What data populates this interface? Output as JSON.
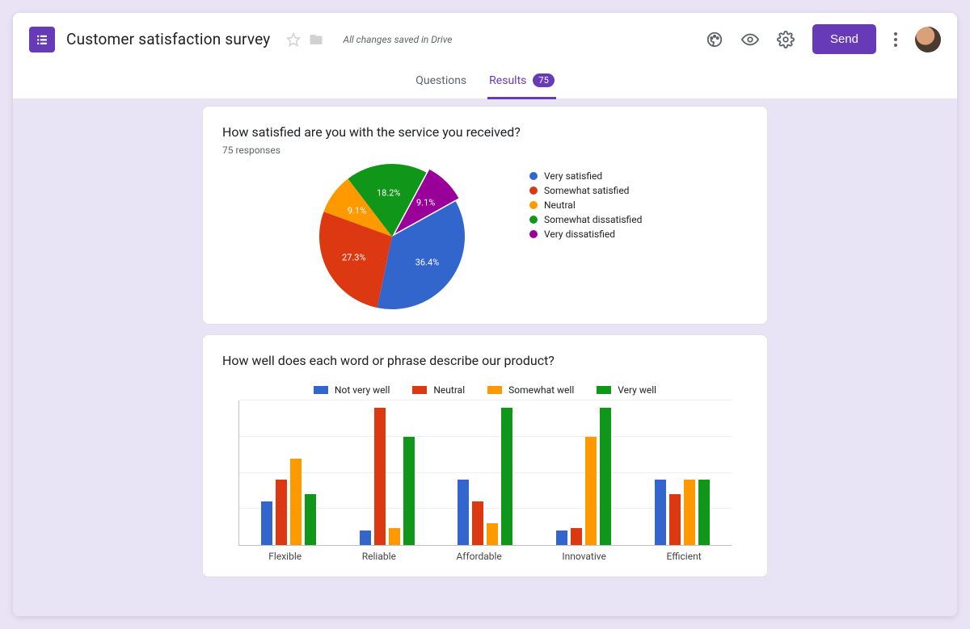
{
  "header": {
    "title": "Customer satisfaction survey",
    "saved_message": "All changes saved in Drive",
    "send_label": "Send"
  },
  "tabs": {
    "questions_label": "Questions",
    "results_label": "Results",
    "results_count": "75"
  },
  "colors": {
    "accent": "#673ab7",
    "series": {
      "blue": "#3366cc",
      "red": "#dc3912",
      "yellow": "#ff9900",
      "green": "#109618",
      "purple": "#990099"
    }
  },
  "question1": {
    "title": "How satisfied are you with the service you received?",
    "responses_label": "75 responses",
    "legend": [
      "Very satisfied",
      "Somewhat satisfied",
      "Neutral",
      "Somewhat dissatisfied",
      "Very dissatisfied"
    ]
  },
  "question2": {
    "title": "How well does each word or phrase describe our product?",
    "legend": [
      "Not very well",
      "Neutral",
      "Somewhat well",
      "Very well"
    ]
  },
  "chart_data": [
    {
      "type": "pie",
      "title": "How satisfied are you with the service you received?",
      "categories": [
        "Very satisfied",
        "Somewhat satisfied",
        "Neutral",
        "Somewhat dissatisfied",
        "Very dissatisfied"
      ],
      "values_pct": [
        36.4,
        27.3,
        9.1,
        18.2,
        9.1
      ],
      "colors": [
        "#3366cc",
        "#dc3912",
        "#ff9900",
        "#109618",
        "#990099"
      ],
      "labels_shown": [
        "36.4%",
        "27.3%",
        "9.1%",
        "18.2%",
        "9.1%"
      ]
    },
    {
      "type": "bar",
      "grouped": true,
      "title": "How well does each word or phrase describe our product?",
      "categories": [
        "Flexible",
        "Reliable",
        "Affordable",
        "Innovative",
        "Efficient"
      ],
      "series": [
        {
          "name": "Not very well",
          "color": "#3366cc",
          "values": [
            30,
            10,
            45,
            10,
            45
          ]
        },
        {
          "name": "Neutral",
          "color": "#dc3912",
          "values": [
            45,
            95,
            30,
            12,
            35
          ]
        },
        {
          "name": "Somewhat well",
          "color": "#ff9900",
          "values": [
            60,
            12,
            15,
            75,
            45
          ]
        },
        {
          "name": "Very well",
          "color": "#109618",
          "values": [
            35,
            75,
            95,
            95,
            45
          ]
        }
      ],
      "ylim": [
        0,
        100
      ],
      "ylabel": "",
      "xlabel": ""
    }
  ]
}
